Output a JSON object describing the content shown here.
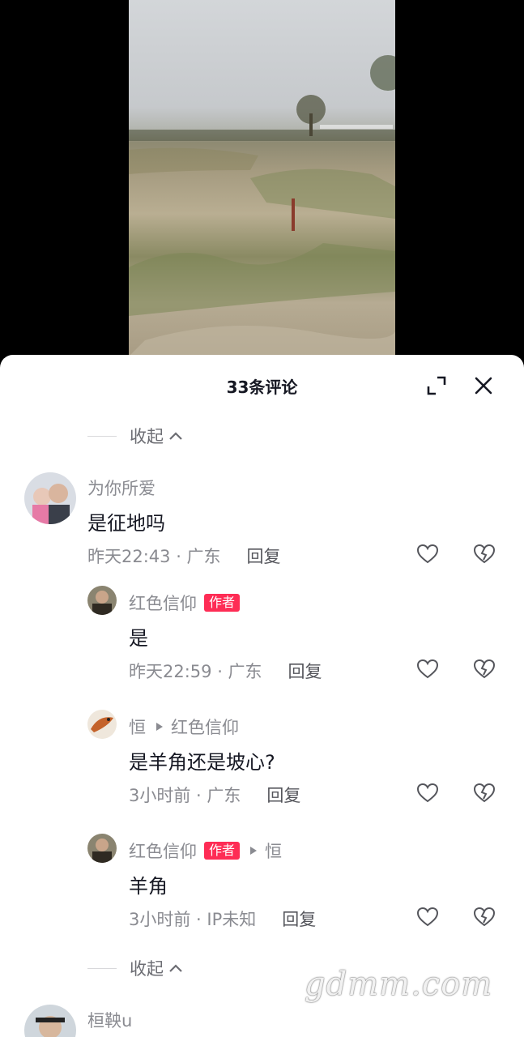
{
  "header": {
    "title": "33条评论",
    "expand_icon": "expand-icon",
    "close_icon": "close-icon"
  },
  "collapse_label": "收起",
  "comments": [
    {
      "user": "为你所爱",
      "text": "是征地吗",
      "time": "昨天22:43 · 广东",
      "reply_label": "回复"
    },
    {
      "user": "红色信仰",
      "badge": "作者",
      "text": "是",
      "time": "昨天22:59 · 广东",
      "reply_label": "回复"
    },
    {
      "user": "恒",
      "reply_to": "红色信仰",
      "text": "是羊角还是坡心?",
      "time": "3小时前 · 广东",
      "reply_label": "回复"
    },
    {
      "user": "红色信仰",
      "badge": "作者",
      "reply_to": "恒",
      "text": "羊角",
      "time": "3小时前 · IP未知",
      "reply_label": "回复"
    },
    {
      "user": "桓鞅u"
    }
  ],
  "watermark": "gdmm.com",
  "colors": {
    "accent": "#fe2c55",
    "text": "#161823",
    "muted": "#8a8b91"
  }
}
